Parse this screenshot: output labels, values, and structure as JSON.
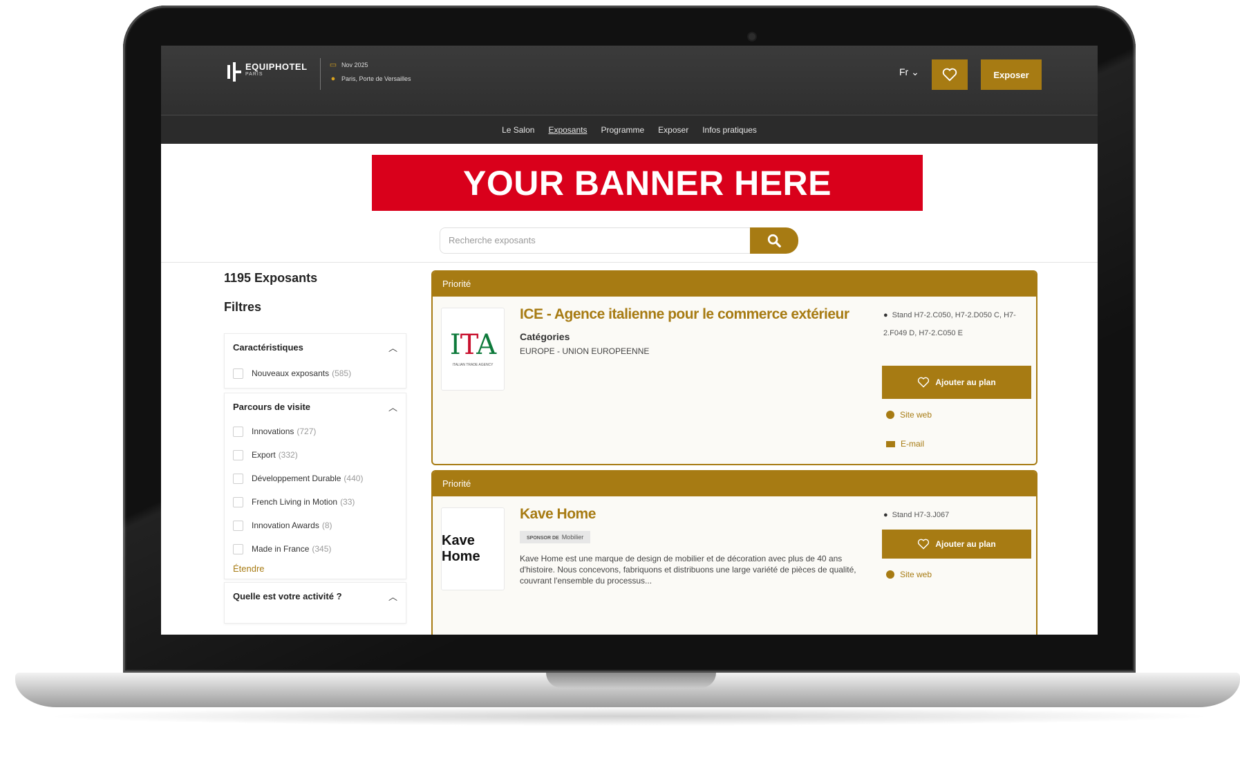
{
  "colors": {
    "accent": "#a77b13",
    "banner": "#d9001b",
    "header_bg": "#333333"
  },
  "header": {
    "logo_text": "EQUIPHOTEL",
    "logo_sub": "PARIS",
    "date": "Nov 2025",
    "location": "Paris, Porte de Versailles",
    "language": "Fr",
    "favorites_icon": "heart-icon",
    "exhibit_button": "Exposer"
  },
  "nav": {
    "items": [
      "Le Salon",
      "Exposants",
      "Programme",
      "Exposer",
      "Infos pratiques"
    ],
    "active_index": 1
  },
  "banner": {
    "text": "YOUR BANNER HERE"
  },
  "search": {
    "placeholder": "Recherche exposants",
    "icon": "search-icon"
  },
  "sidebar": {
    "count": "1195 Exposants",
    "filters_title": "Filtres",
    "caracteristiques": {
      "title": "Caractéristiques",
      "options": [
        {
          "label": "Nouveaux exposants",
          "count": "(585)"
        }
      ]
    },
    "parcours": {
      "title": "Parcours de visite",
      "options": [
        {
          "label": "Innovations",
          "count": "(727)"
        },
        {
          "label": "Export",
          "count": "(332)"
        },
        {
          "label": "Développement Durable",
          "count": "(440)"
        },
        {
          "label": "French Living in Motion",
          "count": "(33)"
        },
        {
          "label": "Innovation Awards",
          "count": "(8)"
        },
        {
          "label": "Made in France",
          "count": "(345)"
        }
      ],
      "more": "Étendre"
    },
    "activite": {
      "title": "Quelle est votre activité ?"
    }
  },
  "exhibitors": [
    {
      "tag": "Priorité",
      "name": "ICE - Agence italienne pour le commerce extérieur",
      "logo_text_1": "I",
      "logo_text_2": "T",
      "logo_text_3": "A",
      "logo_sub": "ITALIAN TRADE AGENCY",
      "categories_label": "Catégories",
      "categories": "EUROPE - UNION EUROPEENNE",
      "stand": "Stand  H7-2.C050, H7-2.D050 C,  H7-2.F049 D, H7-2.C050 E",
      "add_button": "Ajouter au plan",
      "website": "Site web",
      "email": "E-mail"
    },
    {
      "tag": "Priorité",
      "name": "Kave Home",
      "logo_text": "Kave Home",
      "sponsor_prefix": "SPONSOR DE",
      "sponsor": "Mobilier",
      "description": "Kave Home est une marque de design de mobilier et de décoration avec plus de 40 ans d'histoire. Nous concevons, fabriquons et distribuons une large variété de pièces de qualité, couvrant l'ensemble du processus...",
      "stand": "Stand  H7-3.J067",
      "add_button": "Ajouter au plan",
      "website": "Site web"
    }
  ]
}
